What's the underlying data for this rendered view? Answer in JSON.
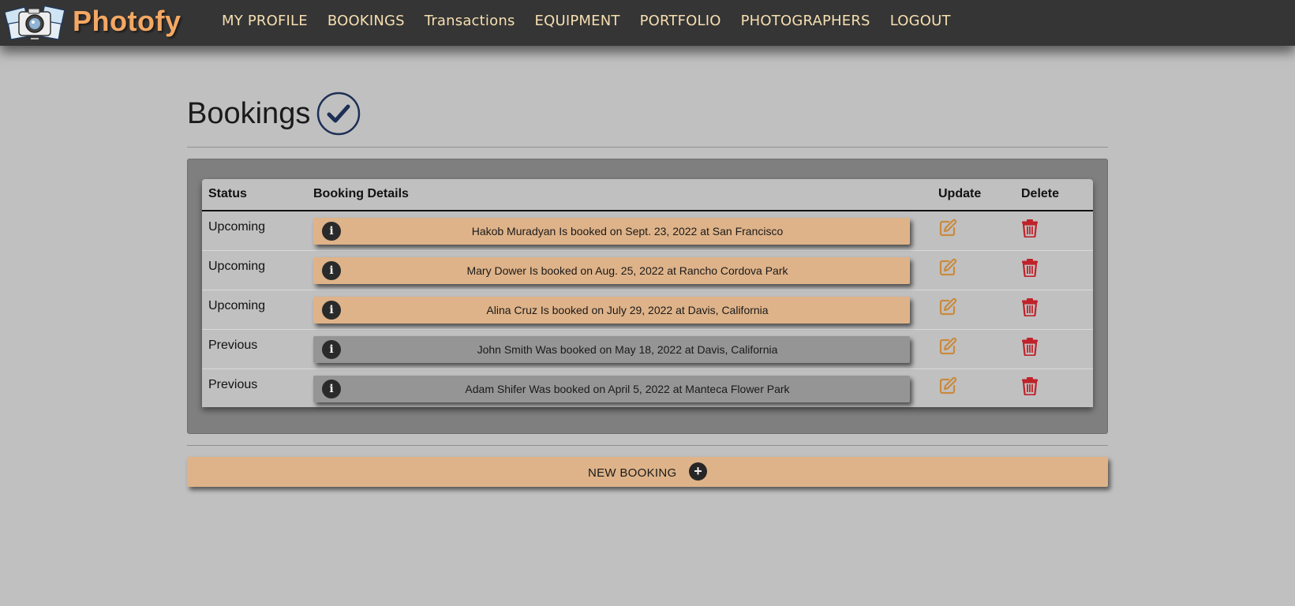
{
  "brand": {
    "name": "Photofy",
    "logo_icon": "camera-photos-icon",
    "color": "#f4a863"
  },
  "nav": {
    "items": [
      {
        "label": "MY PROFILE"
      },
      {
        "label": "BOOKINGS"
      },
      {
        "label": "Transactions"
      },
      {
        "label": "EQUIPMENT"
      },
      {
        "label": "PORTFOLIO"
      },
      {
        "label": "PHOTOGRAPHERS"
      },
      {
        "label": "LOGOUT"
      }
    ]
  },
  "page": {
    "title": "Bookings",
    "title_icon": "check-circle-icon"
  },
  "table": {
    "headers": {
      "status": "Status",
      "details": "Booking Details",
      "update": "Update",
      "delete": "Delete"
    },
    "rows": [
      {
        "status": "Upcoming",
        "detail": "Hakob Muradyan Is booked on Sept. 23, 2022 at San Francisco",
        "kind": "upcoming"
      },
      {
        "status": "Upcoming",
        "detail": "Mary Dower Is booked on Aug. 25, 2022 at Rancho Cordova Park",
        "kind": "upcoming"
      },
      {
        "status": "Upcoming",
        "detail": "Alina Cruz Is booked on July 29, 2022 at Davis, California",
        "kind": "upcoming"
      },
      {
        "status": "Previous",
        "detail": "John Smith Was booked on May 18, 2022 at Davis, California",
        "kind": "previous"
      },
      {
        "status": "Previous",
        "detail": "Adam Shifer Was booked on April 5, 2022 at Manteca Flower Park",
        "kind": "previous"
      }
    ]
  },
  "new_booking": {
    "label": "NEW BOOKING",
    "icon": "plus-circle-icon"
  },
  "colors": {
    "navbar": "#353535",
    "background": "#c0c0c0",
    "upcoming": "#dfb389",
    "previous": "#959595",
    "edit_icon": "#c98a3e",
    "delete_icon": "#c0222a",
    "check_icon": "#1d2f55"
  }
}
